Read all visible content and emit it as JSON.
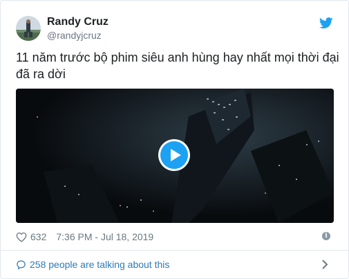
{
  "author": {
    "name": "Randy Cruz",
    "handle": "@randyjcruz"
  },
  "tweet": {
    "text_line1": "11 năm trước bộ phim siêu anh hùng hay nhất mọi thời đại",
    "text_line2": "đã ra dời"
  },
  "stats": {
    "likes": "632",
    "timestamp": "7:36 PM - Jul 18, 2019"
  },
  "footer": {
    "talking_label": "258 people are talking about this"
  },
  "icons": {
    "logo": "twitter-bird-icon",
    "play": "play-icon",
    "like": "heart-icon",
    "info": "info-icon",
    "reply": "speech-bubble-icon",
    "more": "chevron-right-icon"
  },
  "colors": {
    "twitter_blue": "#1da1f2",
    "link_blue": "#2b7bb9",
    "meta_gray": "#697882",
    "text": "#1c2022",
    "border": "#e1e8ed"
  }
}
